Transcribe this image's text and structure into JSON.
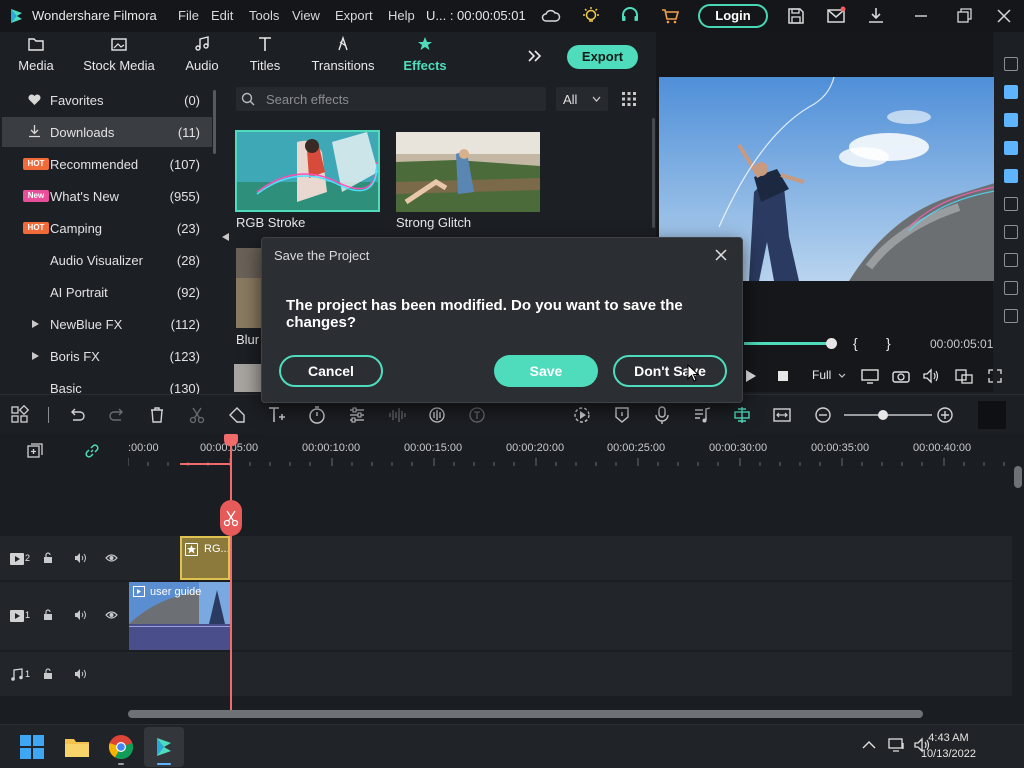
{
  "titlebar": {
    "app_name": "Wondershare Filmora",
    "menus": [
      "File",
      "Edit",
      "Tools",
      "View",
      "Export",
      "Help"
    ],
    "project": "U... : 00:00:05:01",
    "login": "Login"
  },
  "tabs": [
    {
      "label": "Media",
      "icon": "folder-icon"
    },
    {
      "label": "Stock Media",
      "icon": "stock-image-icon"
    },
    {
      "label": "Audio",
      "icon": "music-note-icon"
    },
    {
      "label": "Titles",
      "icon": "text-t-icon"
    },
    {
      "label": "Transitions",
      "icon": "transition-icon"
    },
    {
      "label": "Effects",
      "icon": "effects-star-icon",
      "active": true
    }
  ],
  "export_label": "Export",
  "sidebar": {
    "items": [
      {
        "label": "Favorites",
        "count": "(0)",
        "icon": "heart-icon"
      },
      {
        "label": "Downloads",
        "count": "(11)",
        "icon": "download-icon",
        "selected": true
      },
      {
        "label": "Recommended",
        "count": "(107)",
        "badge": "HOT"
      },
      {
        "label": "What's New",
        "count": "(955)",
        "badge": "New"
      },
      {
        "label": "Camping",
        "count": "(23)",
        "badge": "HOT"
      },
      {
        "label": "Audio Visualizer",
        "count": "(28)"
      },
      {
        "label": "AI Portrait",
        "count": "(92)"
      },
      {
        "label": "NewBlue FX",
        "count": "(112)",
        "expandable": true
      },
      {
        "label": "Boris FX",
        "count": "(123)",
        "expandable": true
      },
      {
        "label": "Basic",
        "count": "(130)"
      }
    ]
  },
  "search": {
    "placeholder": "Search effects",
    "filter": "All"
  },
  "effects": [
    {
      "label": "RGB Stroke",
      "selected": true
    },
    {
      "label": "Strong Glitch"
    },
    {
      "label": "Blur"
    }
  ],
  "dialog": {
    "title": "Save the Project",
    "message": "The project has been modified. Do you want to save the changes?",
    "cancel": "Cancel",
    "save": "Save",
    "dont_save": "Don't Save"
  },
  "player": {
    "timecode": "00:00:05:01",
    "quality": "Full",
    "mark_in": "{",
    "mark_out": "}"
  },
  "timeline": {
    "ruler": [
      ":00:00",
      "00:00:05:00",
      "00:00:10:00",
      "00:00:15:00",
      "00:00:20:00",
      "00:00:25:00",
      "00:00:30:00",
      "00:00:35:00",
      "00:00:40:00"
    ],
    "tracks": [
      {
        "number": "2",
        "type": "video"
      },
      {
        "number": "1",
        "type": "video"
      },
      {
        "number": "1",
        "type": "audio"
      }
    ],
    "clips": {
      "effect": "RG...",
      "video": "user guide"
    }
  },
  "taskbar": {
    "time": "4:43 AM",
    "date": "10/13/2022"
  },
  "colors": {
    "accent": "#4fdcbd",
    "playhead": "#f26b6b",
    "effect_clip": "#8c7a3c",
    "video_clip": "#4a4f8c"
  }
}
